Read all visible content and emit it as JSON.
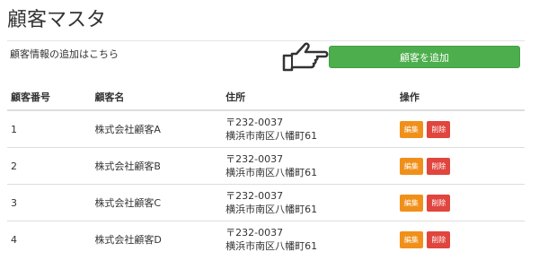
{
  "header": {
    "title": "顧客マスタ"
  },
  "add_section": {
    "text": "顧客情報の追加はこちら",
    "button_label": "顧客を追加"
  },
  "table": {
    "columns": [
      "顧客番号",
      "顧客名",
      "住所",
      "操作"
    ],
    "rows": [
      {
        "id": "1",
        "name": "株式会社顧客A",
        "postal": "〒232-0037",
        "address": "横浜市南区八幡町61",
        "edit": "編集",
        "delete": "削除"
      },
      {
        "id": "2",
        "name": "株式会社顧客B",
        "postal": "〒232-0037",
        "address": "横浜市南区八幡町61",
        "edit": "編集",
        "delete": "削除"
      },
      {
        "id": "3",
        "name": "株式会社顧客C",
        "postal": "〒232-0037",
        "address": "横浜市南区八幡町61",
        "edit": "編集",
        "delete": "削除"
      },
      {
        "id": "4",
        "name": "株式会社顧客D",
        "postal": "〒232-0037",
        "address": "横浜市南区八幡町61",
        "edit": "編集",
        "delete": "削除"
      }
    ]
  },
  "icons": {
    "pointer": "pointing-hand-icon"
  },
  "colors": {
    "add_button": "#4cae4c",
    "edit_button": "#f0901a",
    "delete_button": "#e0453e"
  }
}
